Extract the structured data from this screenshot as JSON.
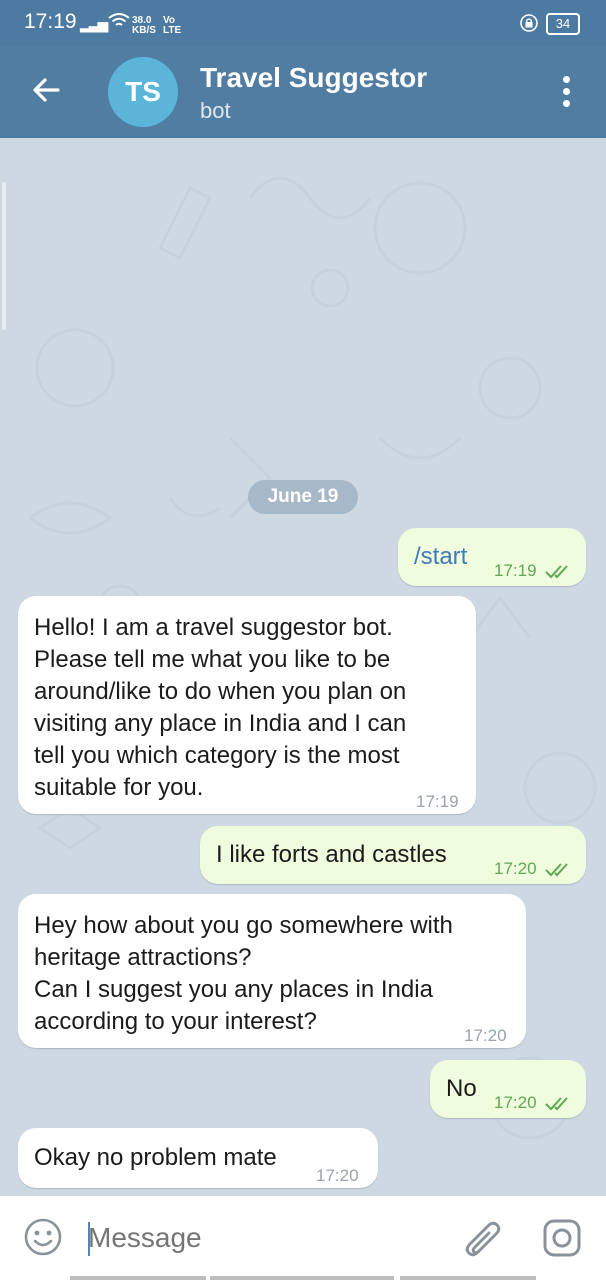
{
  "status_bar": {
    "time": "17:19",
    "speed_value": "38.0",
    "speed_unit": "KB/S",
    "network_top": "Vo",
    "network_bottom": "LTE",
    "battery": "34"
  },
  "header": {
    "avatar_initials": "TS",
    "title": "Travel Suggestor",
    "subtitle": "bot",
    "color": "#527da3"
  },
  "chat": {
    "date_label": "June 19",
    "messages": [
      {
        "direction": "outgoing",
        "text": "/start",
        "time": "17:19",
        "read": true
      },
      {
        "direction": "incoming",
        "lines": [
          "Hello! I am a travel suggestor bot.",
          "Please tell me what you like to be",
          "around/like to do when you plan on",
          "visiting any place in India and I can",
          "tell you which category is the most",
          "suitable for you."
        ],
        "time": "17:19"
      },
      {
        "direction": "outgoing",
        "text": "I like forts and castles",
        "time": "17:20",
        "read": true
      },
      {
        "direction": "incoming",
        "lines": [
          "Hey how about you go somewhere with",
          "heritage attractions?",
          "Can I suggest you any places in India",
          "according to your interest?"
        ],
        "time": "17:20"
      },
      {
        "direction": "outgoing",
        "text": "No",
        "time": "17:20",
        "read": true
      },
      {
        "direction": "incoming",
        "lines": [
          "Okay no problem mate"
        ],
        "time": "17:20"
      }
    ]
  },
  "input": {
    "placeholder": "Message"
  },
  "colors": {
    "outgoing_bubble": "#effdde",
    "incoming_bubble": "#ffffff",
    "chat_background": "#cdd8e2",
    "read_ticks": "#5fa854"
  },
  "icons": [
    "back-arrow-icon",
    "more-vert-icon",
    "emoji-icon",
    "attach-icon",
    "camera-icon",
    "double-check-icon",
    "wifi-icon",
    "lock-icon"
  ]
}
